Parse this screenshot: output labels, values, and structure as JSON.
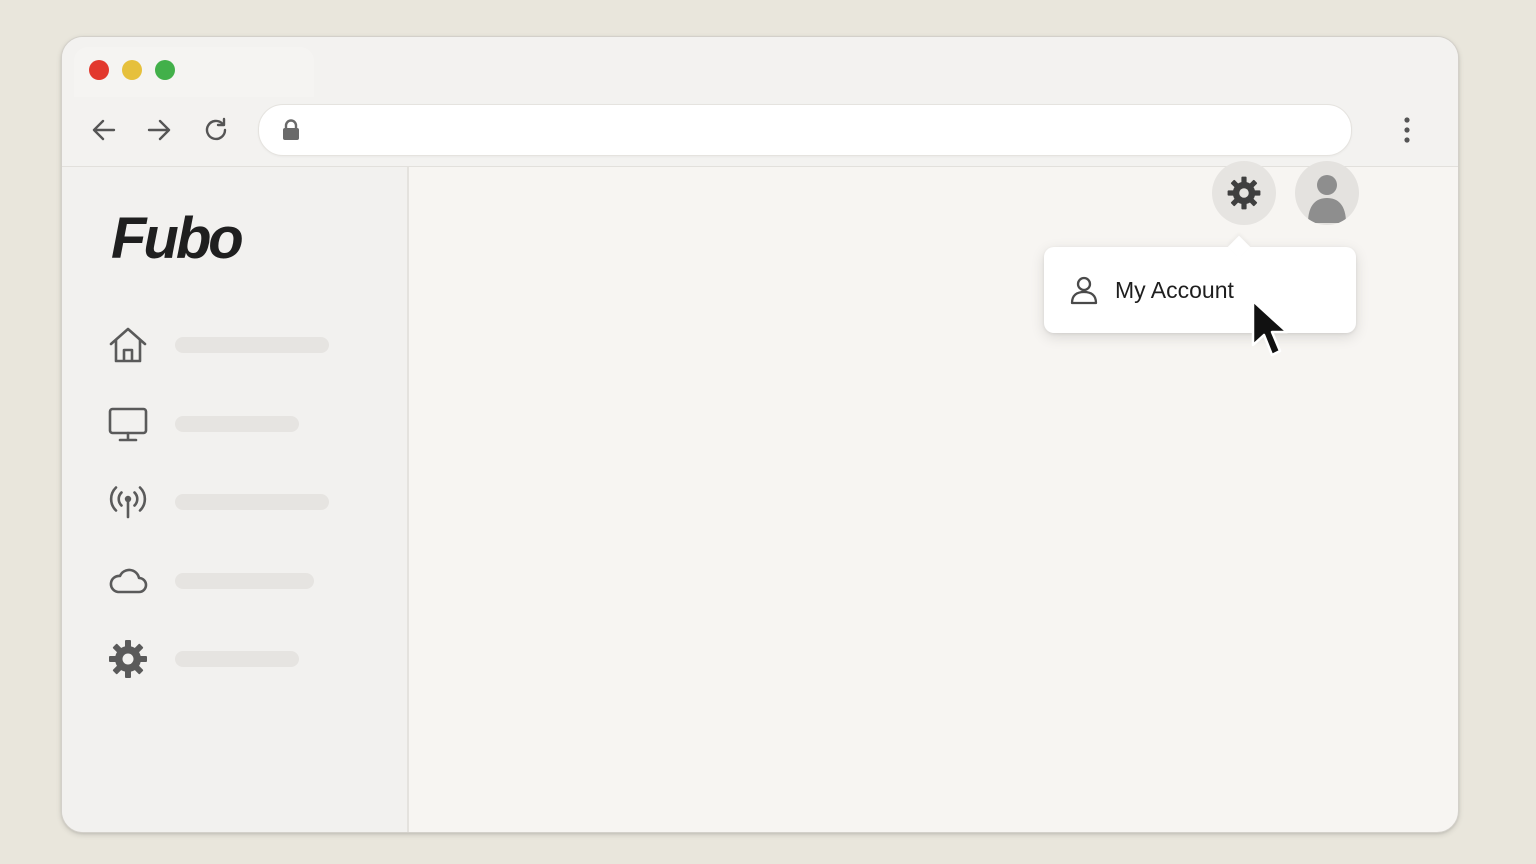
{
  "browser": {
    "url": "",
    "traffic_lights": {
      "close": "#e2382d",
      "minimize": "#e6c03c",
      "maximize": "#42b04a"
    },
    "icons": {
      "back": "arrow-left-icon",
      "forward": "arrow-right-icon",
      "reload": "reload-icon",
      "lock": "lock-icon",
      "menu": "kebab-menu-icon"
    }
  },
  "app": {
    "logo": "Fubo",
    "sidebar": {
      "items": [
        {
          "icon": "home-icon",
          "label": ""
        },
        {
          "icon": "tv-icon",
          "label": ""
        },
        {
          "icon": "live-broadcast-icon",
          "label": ""
        },
        {
          "icon": "cloud-icon",
          "label": ""
        },
        {
          "icon": "settings-icon",
          "label": ""
        }
      ]
    },
    "header": {
      "settings_icon": "gear-icon",
      "avatar_icon": "user-avatar-icon"
    },
    "dropdown": {
      "items": [
        {
          "icon": "user-icon",
          "label": "My Account"
        }
      ]
    }
  },
  "colors": {
    "background": "#e9e6dc",
    "window": "#f7f5f2",
    "sidebar": "#f2f1ef",
    "icon": "#5a5a5a",
    "text": "#1e1e1e"
  }
}
